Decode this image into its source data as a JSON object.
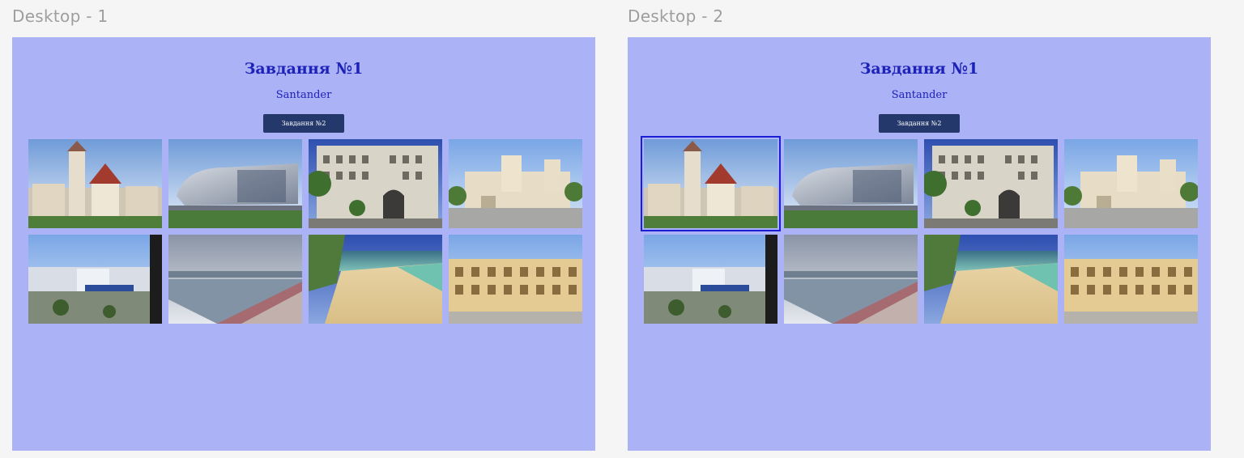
{
  "frames": [
    {
      "label": "Desktop - 1",
      "title": "Завдання №1",
      "subtitle": "Santander",
      "button_label": "Завдання №2"
    },
    {
      "label": "Desktop - 2",
      "title": "Завдання №1",
      "subtitle": "Santander",
      "button_label": "Завдання №2"
    }
  ],
  "colors": {
    "canvas": "#f5f5f5",
    "frame_bg": "#abb2f5",
    "heading": "#1d22b8",
    "button": "#24386b",
    "selection": "#1a1fd6"
  },
  "photos": [
    "palace-photo",
    "modern-building-photo",
    "ornate-building-photo",
    "cathedral-photo",
    "seaside-promenade-photo",
    "city-bay-photo",
    "beach-photo",
    "plaza-photo"
  ],
  "selected_photo_in_frame_2": 1
}
